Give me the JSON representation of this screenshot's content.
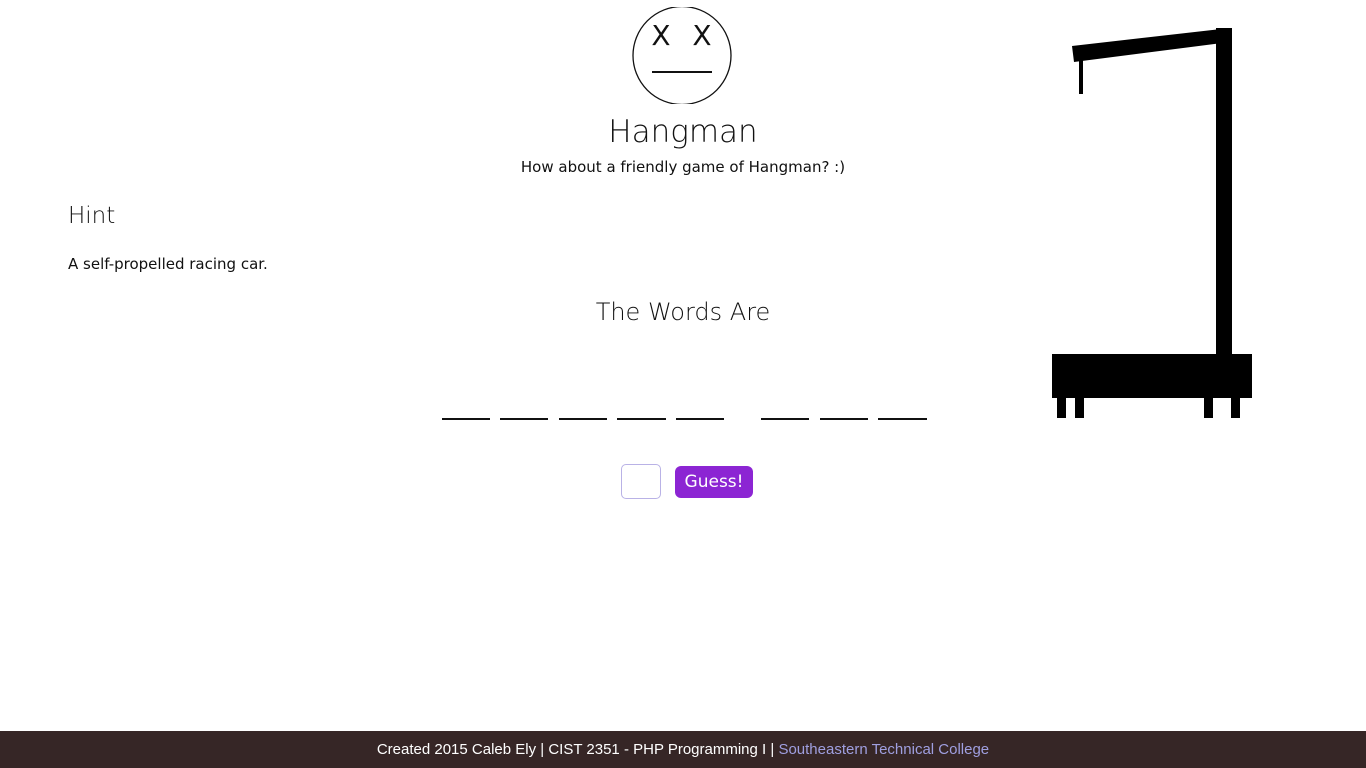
{
  "header": {
    "logo_icon": "dead-face-icon",
    "title": "Hangman",
    "subtitle": "How about a friendly game of Hangman? :)"
  },
  "hint": {
    "heading": "Hint",
    "text": "A self-propelled racing car."
  },
  "words": {
    "heading": "The Words Are",
    "word_lengths": [
      5,
      3
    ],
    "guessed_letters": [
      "",
      "",
      "",
      "",
      "",
      "",
      "",
      ""
    ]
  },
  "guess_form": {
    "input_value": "",
    "button_label": "Guess!",
    "button_color": "#8c25d3"
  },
  "gallows": {
    "icon": "gallows-icon",
    "body_parts_shown": 0
  },
  "footer": {
    "credit": "Created 2015 Caleb Ely | CIST 2351 - PHP Programming I | ",
    "link_text": "Southeastern Technical College",
    "background": "#362626",
    "link_color": "#9f9fe0"
  }
}
